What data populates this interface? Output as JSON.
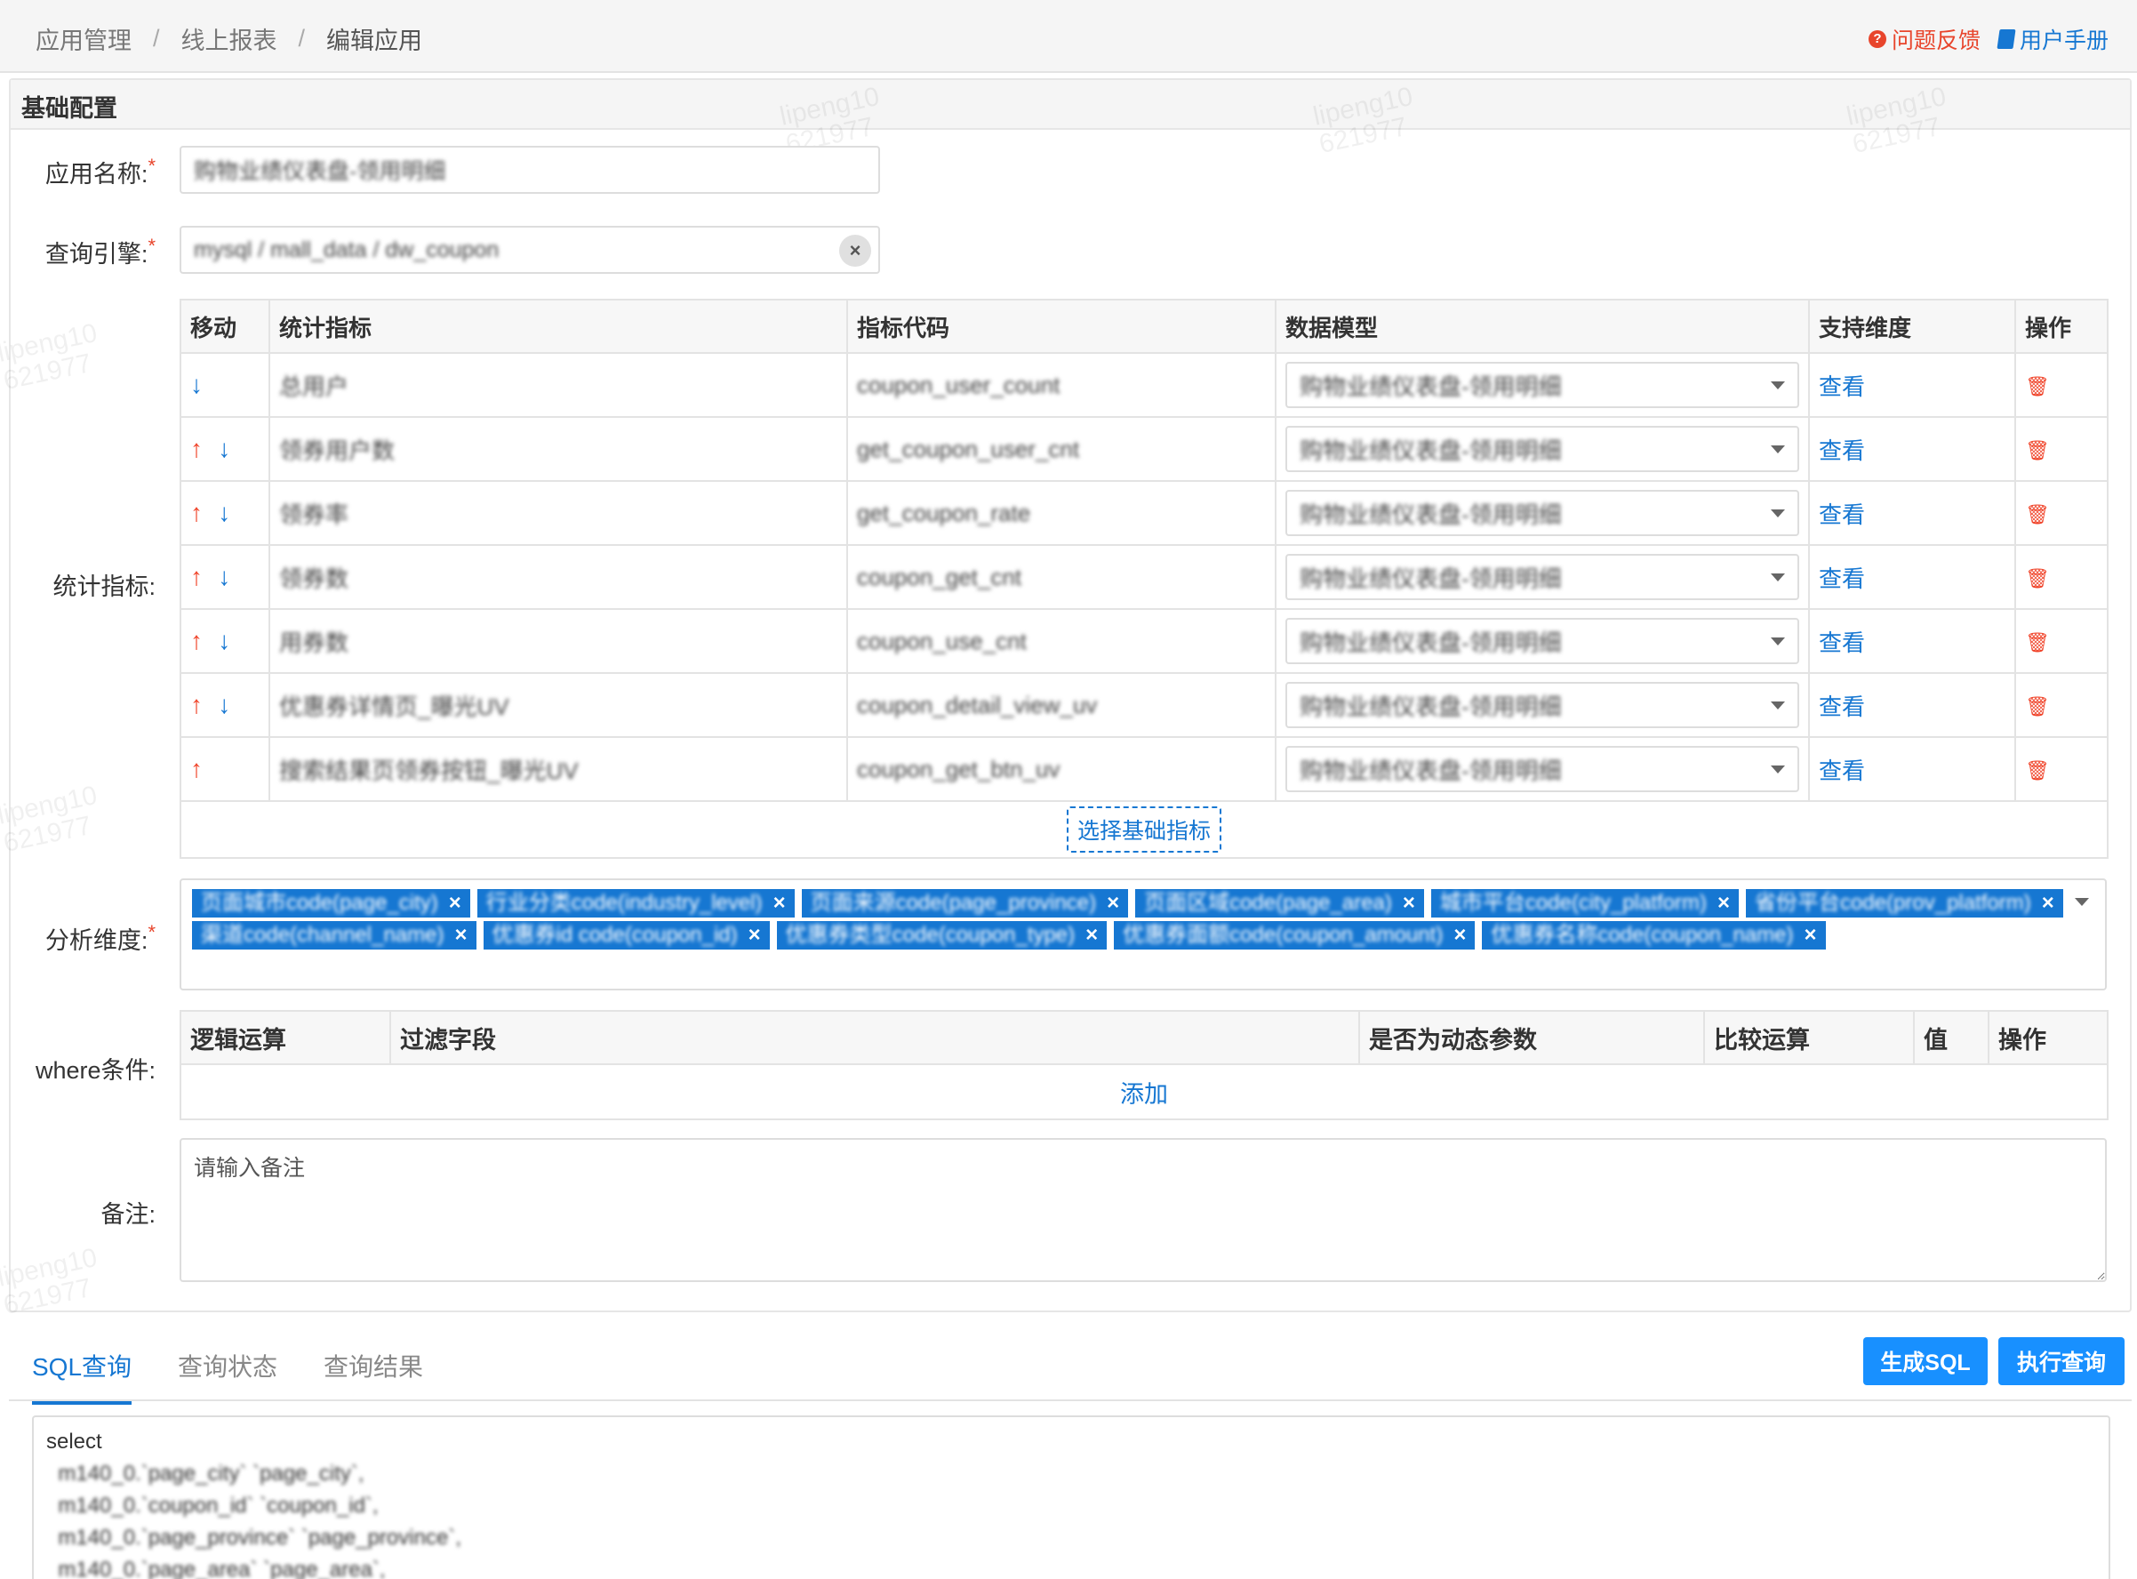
{
  "breadcrumb": [
    "应用管理",
    "线上报表",
    "编辑应用"
  ],
  "header_links": {
    "feedback": "问题反馈",
    "manual": "用户手册"
  },
  "panel_title": "基础配置",
  "form": {
    "app_name_label": "应用名称:",
    "app_name_value": "购物业绩仪表盘-领用明细",
    "engine_label": "查询引擎:",
    "engine_value": "mysql / mall_data / dw_coupon",
    "metrics_label": "统计指标:",
    "dimension_label": "分析维度:",
    "where_label": "where条件:",
    "note_label": "备注:",
    "note_placeholder": "请输入备注",
    "required_mark": "*"
  },
  "metric_table": {
    "headers": [
      "移动",
      "统计指标",
      "指标代码",
      "数据模型",
      "支持维度",
      "操作"
    ],
    "rows": [
      {
        "up": false,
        "down": true,
        "name": "总用户",
        "code": "coupon_user_count",
        "model": "购物业绩仪表盘-领用明细",
        "view": "查看"
      },
      {
        "up": true,
        "down": true,
        "name": "领券用户数",
        "code": "get_coupon_user_cnt",
        "model": "购物业绩仪表盘-领用明细",
        "view": "查看"
      },
      {
        "up": true,
        "down": true,
        "name": "领券率",
        "code": "get_coupon_rate",
        "model": "购物业绩仪表盘-领用明细",
        "view": "查看"
      },
      {
        "up": true,
        "down": true,
        "name": "领券数",
        "code": "coupon_get_cnt",
        "model": "购物业绩仪表盘-领用明细",
        "view": "查看"
      },
      {
        "up": true,
        "down": true,
        "name": "用券数",
        "code": "coupon_use_cnt",
        "model": "购物业绩仪表盘-领用明细",
        "view": "查看"
      },
      {
        "up": true,
        "down": true,
        "name": "优惠券详情页_曝光UV",
        "code": "coupon_detail_view_uv",
        "model": "购物业绩仪表盘-领用明细",
        "view": "查看"
      },
      {
        "up": true,
        "down": false,
        "name": "搜索结果页领券按钮_曝光UV",
        "code": "coupon_get_btn_uv",
        "model": "购物业绩仪表盘-领用明细",
        "view": "查看"
      }
    ],
    "choose_label": "选择基础指标"
  },
  "dimension_tags": [
    "页面城市code(page_city)",
    "行业分类code(industry_level)",
    "页面来源code(page_province)",
    "页面区域code(page_area)",
    "城市平台code(city_platform)",
    "省份平台code(prov_platform)",
    "渠道code(channel_name)",
    "优惠券id code(coupon_id)",
    "优惠券类型code(coupon_type)",
    "优惠券面额code(coupon_amount)",
    "优惠券名称code(coupon_name)"
  ],
  "where_table": {
    "headers": [
      "逻辑运算",
      "过滤字段",
      "是否为动态参数",
      "比较运算",
      "值",
      "操作"
    ],
    "add_label": "添加"
  },
  "tabs": [
    "SQL查询",
    "查询状态",
    "查询结果"
  ],
  "buttons": {
    "gen_sql": "生成SQL",
    "run_query": "执行查询"
  },
  "sql_lines": [
    "select",
    "  m140_0.`page_city` `page_city`,",
    "  m140_0.`coupon_id` `coupon_id`,",
    "  m140_0.`page_province` `page_province`,",
    "  m140_0.`page_area` `page_area`,"
  ],
  "watermark": [
    "lipeng10",
    "621977"
  ]
}
